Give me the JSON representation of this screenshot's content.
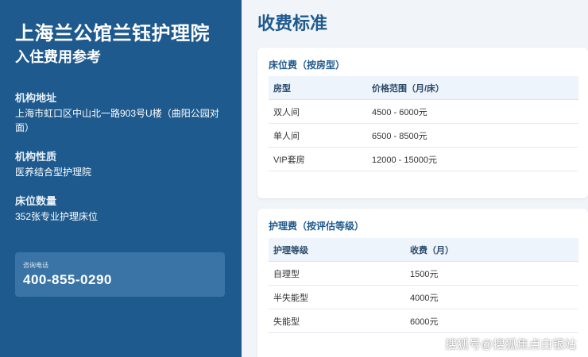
{
  "sidebar": {
    "org_name": "上海兰公馆兰钰护理院",
    "subtitle": "入住费用参考",
    "address_label": "机构地址",
    "address_value": "上海市虹口区中山北一路903号U楼（曲阳公园对面）",
    "nature_label": "机构性质",
    "nature_value": "医养结合型护理院",
    "beds_label": "床位数量",
    "beds_value": "352张专业护理床位",
    "phone_label": "咨询电话",
    "phone_number": "400-855-0290"
  },
  "main": {
    "title": "收费标准",
    "bed_fee": {
      "title": "床位费（按房型）",
      "headers": [
        "房型",
        "价格范围（月/床）"
      ],
      "rows": [
        [
          "双人间",
          "4500 - 6000元"
        ],
        [
          "单人间",
          "6500 - 8500元"
        ],
        [
          "VIP套房",
          "12000 - 15000元"
        ]
      ]
    },
    "care_fee": {
      "title": "护理费（按评估等级）",
      "headers": [
        "护理等级",
        "收费（月）"
      ],
      "rows": [
        [
          "自理型",
          "1500元"
        ],
        [
          "半失能型",
          "4000元"
        ],
        [
          "失能型",
          "6000元"
        ]
      ]
    }
  },
  "watermark": "搜狐号@搜狐焦点白银站"
}
